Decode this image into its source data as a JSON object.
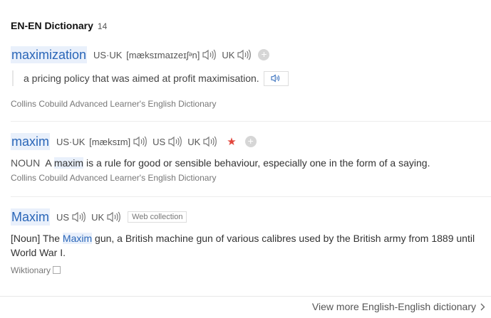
{
  "header": {
    "title": "EN-EN Dictionary",
    "count": "14"
  },
  "entries": [
    {
      "word": "maximization",
      "phonetic_label": "US·UK",
      "phonetic": "[mæksɪmaɪzeɪʃᵊn]",
      "uk_label": "UK",
      "example": "a pricing policy that was aimed at profit maximisation.",
      "source": "Collins Cobuild Advanced Learner's English Dictionary"
    },
    {
      "word": "maxim",
      "phonetic_label": "US·UK",
      "phonetic": "[mæksɪm]",
      "us_label": "US",
      "uk_label": "UK",
      "pos": "NOUN",
      "def_before": "A",
      "def_hl": "maxim",
      "def_after": "is a rule for good or sensible behaviour, especially one in the form of a saying.",
      "source": "Collins Cobuild Advanced Learner's English Dictionary"
    },
    {
      "word": "Maxim",
      "us_label": "US",
      "uk_label": "UK",
      "tag": "Web collection",
      "def_before": "[Noun] The",
      "def_hl": "Maxim",
      "def_after": "gun, a British machine gun of various calibres used by the British army from 1889 until World War I.",
      "source": "Wiktionary"
    }
  ],
  "footer": {
    "more_label": "View more English-English dictionary"
  },
  "colors": {
    "accent": "#2a66b8",
    "highlight_bg": "#e9f0fb",
    "star": "#e2463c"
  },
  "icons": [
    "speaker-icon",
    "add-icon",
    "star-icon",
    "copy-icon",
    "chevron-right-icon"
  ]
}
